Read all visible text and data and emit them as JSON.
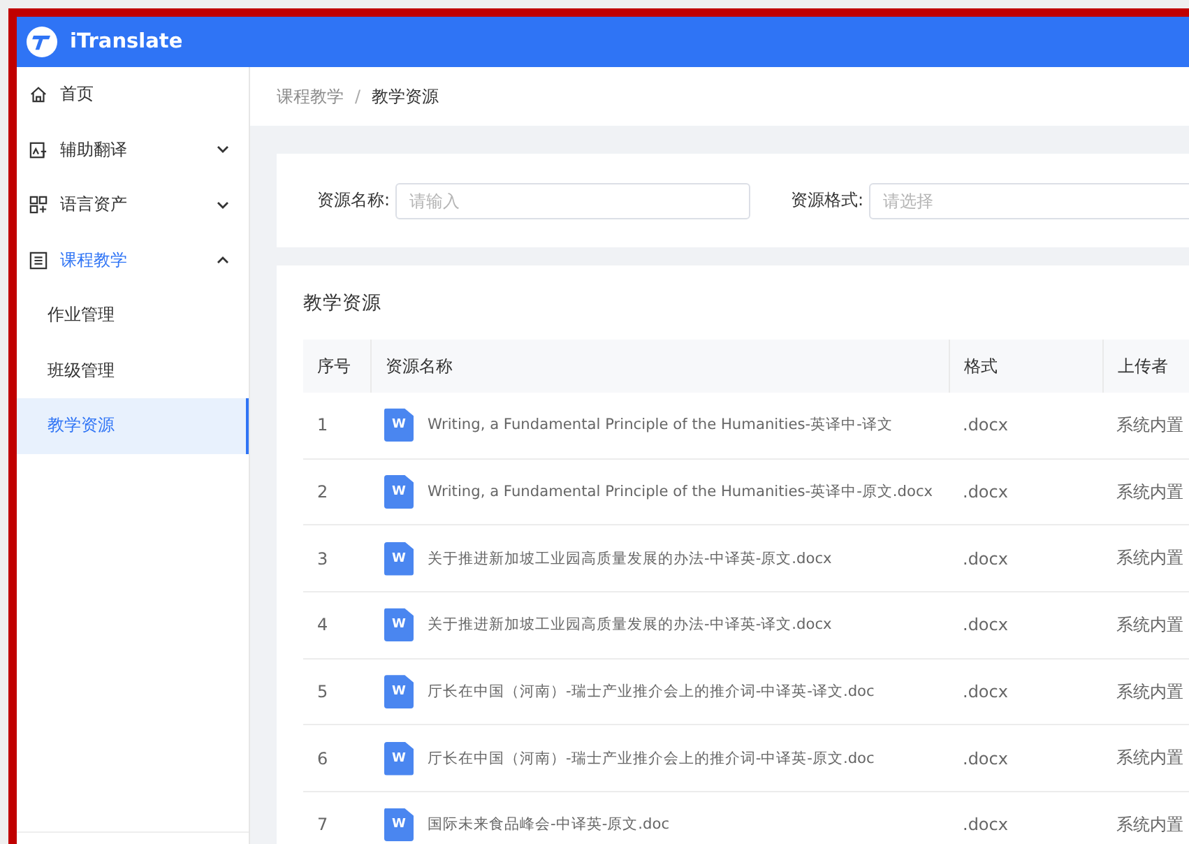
{
  "app": {
    "title": "iTranslate"
  },
  "sidebar": {
    "items": [
      {
        "label": "首页",
        "kind": "link"
      },
      {
        "label": "辅助翻译",
        "kind": "group",
        "expanded": false
      },
      {
        "label": "语言资产",
        "kind": "group",
        "expanded": false
      },
      {
        "label": "课程教学",
        "kind": "group",
        "expanded": true,
        "children": [
          {
            "label": "作业管理",
            "selected": false
          },
          {
            "label": "班级管理",
            "selected": false
          },
          {
            "label": "教学资源",
            "selected": true
          }
        ]
      }
    ]
  },
  "breadcrumb": {
    "items": [
      "课程教学",
      "教学资源"
    ],
    "separator": "/"
  },
  "filters": [
    {
      "label": "资源名称:",
      "placeholder": "请输入",
      "kind": "input"
    },
    {
      "label": "资源格式:",
      "placeholder": "请选择",
      "kind": "select"
    }
  ],
  "table": {
    "title": "教学资源",
    "columns": [
      "序号",
      "资源名称",
      "格式",
      "上传者"
    ],
    "rows": [
      {
        "index": "1",
        "badge": "W",
        "name": "Writing, a Fundamental Principle of the Humanities-英译中-译文",
        "format": ".docx",
        "uploader": "系统内置"
      },
      {
        "index": "2",
        "badge": "W",
        "name": "Writing, a Fundamental Principle of the Humanities-英译中-原文.docx",
        "format": ".docx",
        "uploader": "系统内置"
      },
      {
        "index": "3",
        "badge": "W",
        "name": "关于推进新加坡工业园高质量发展的办法-中译英-原文.docx",
        "format": ".docx",
        "uploader": "系统内置"
      },
      {
        "index": "4",
        "badge": "W",
        "name": "关于推进新加坡工业园高质量发展的办法-中译英-译文.docx",
        "format": ".docx",
        "uploader": "系统内置"
      },
      {
        "index": "5",
        "badge": "W",
        "name": "厅长在中国（河南）-瑞士产业推介会上的推介词-中译英-译文.doc",
        "format": ".docx",
        "uploader": "系统内置"
      },
      {
        "index": "6",
        "badge": "W",
        "name": "厅长在中国（河南）-瑞士产业推介会上的推介词-中译英-原文.doc",
        "format": ".docx",
        "uploader": "系统内置"
      },
      {
        "index": "7",
        "badge": "W",
        "name": "国际未来食品峰会-中译英-原文.doc",
        "format": ".docx",
        "uploader": "系统内置"
      }
    ]
  }
}
